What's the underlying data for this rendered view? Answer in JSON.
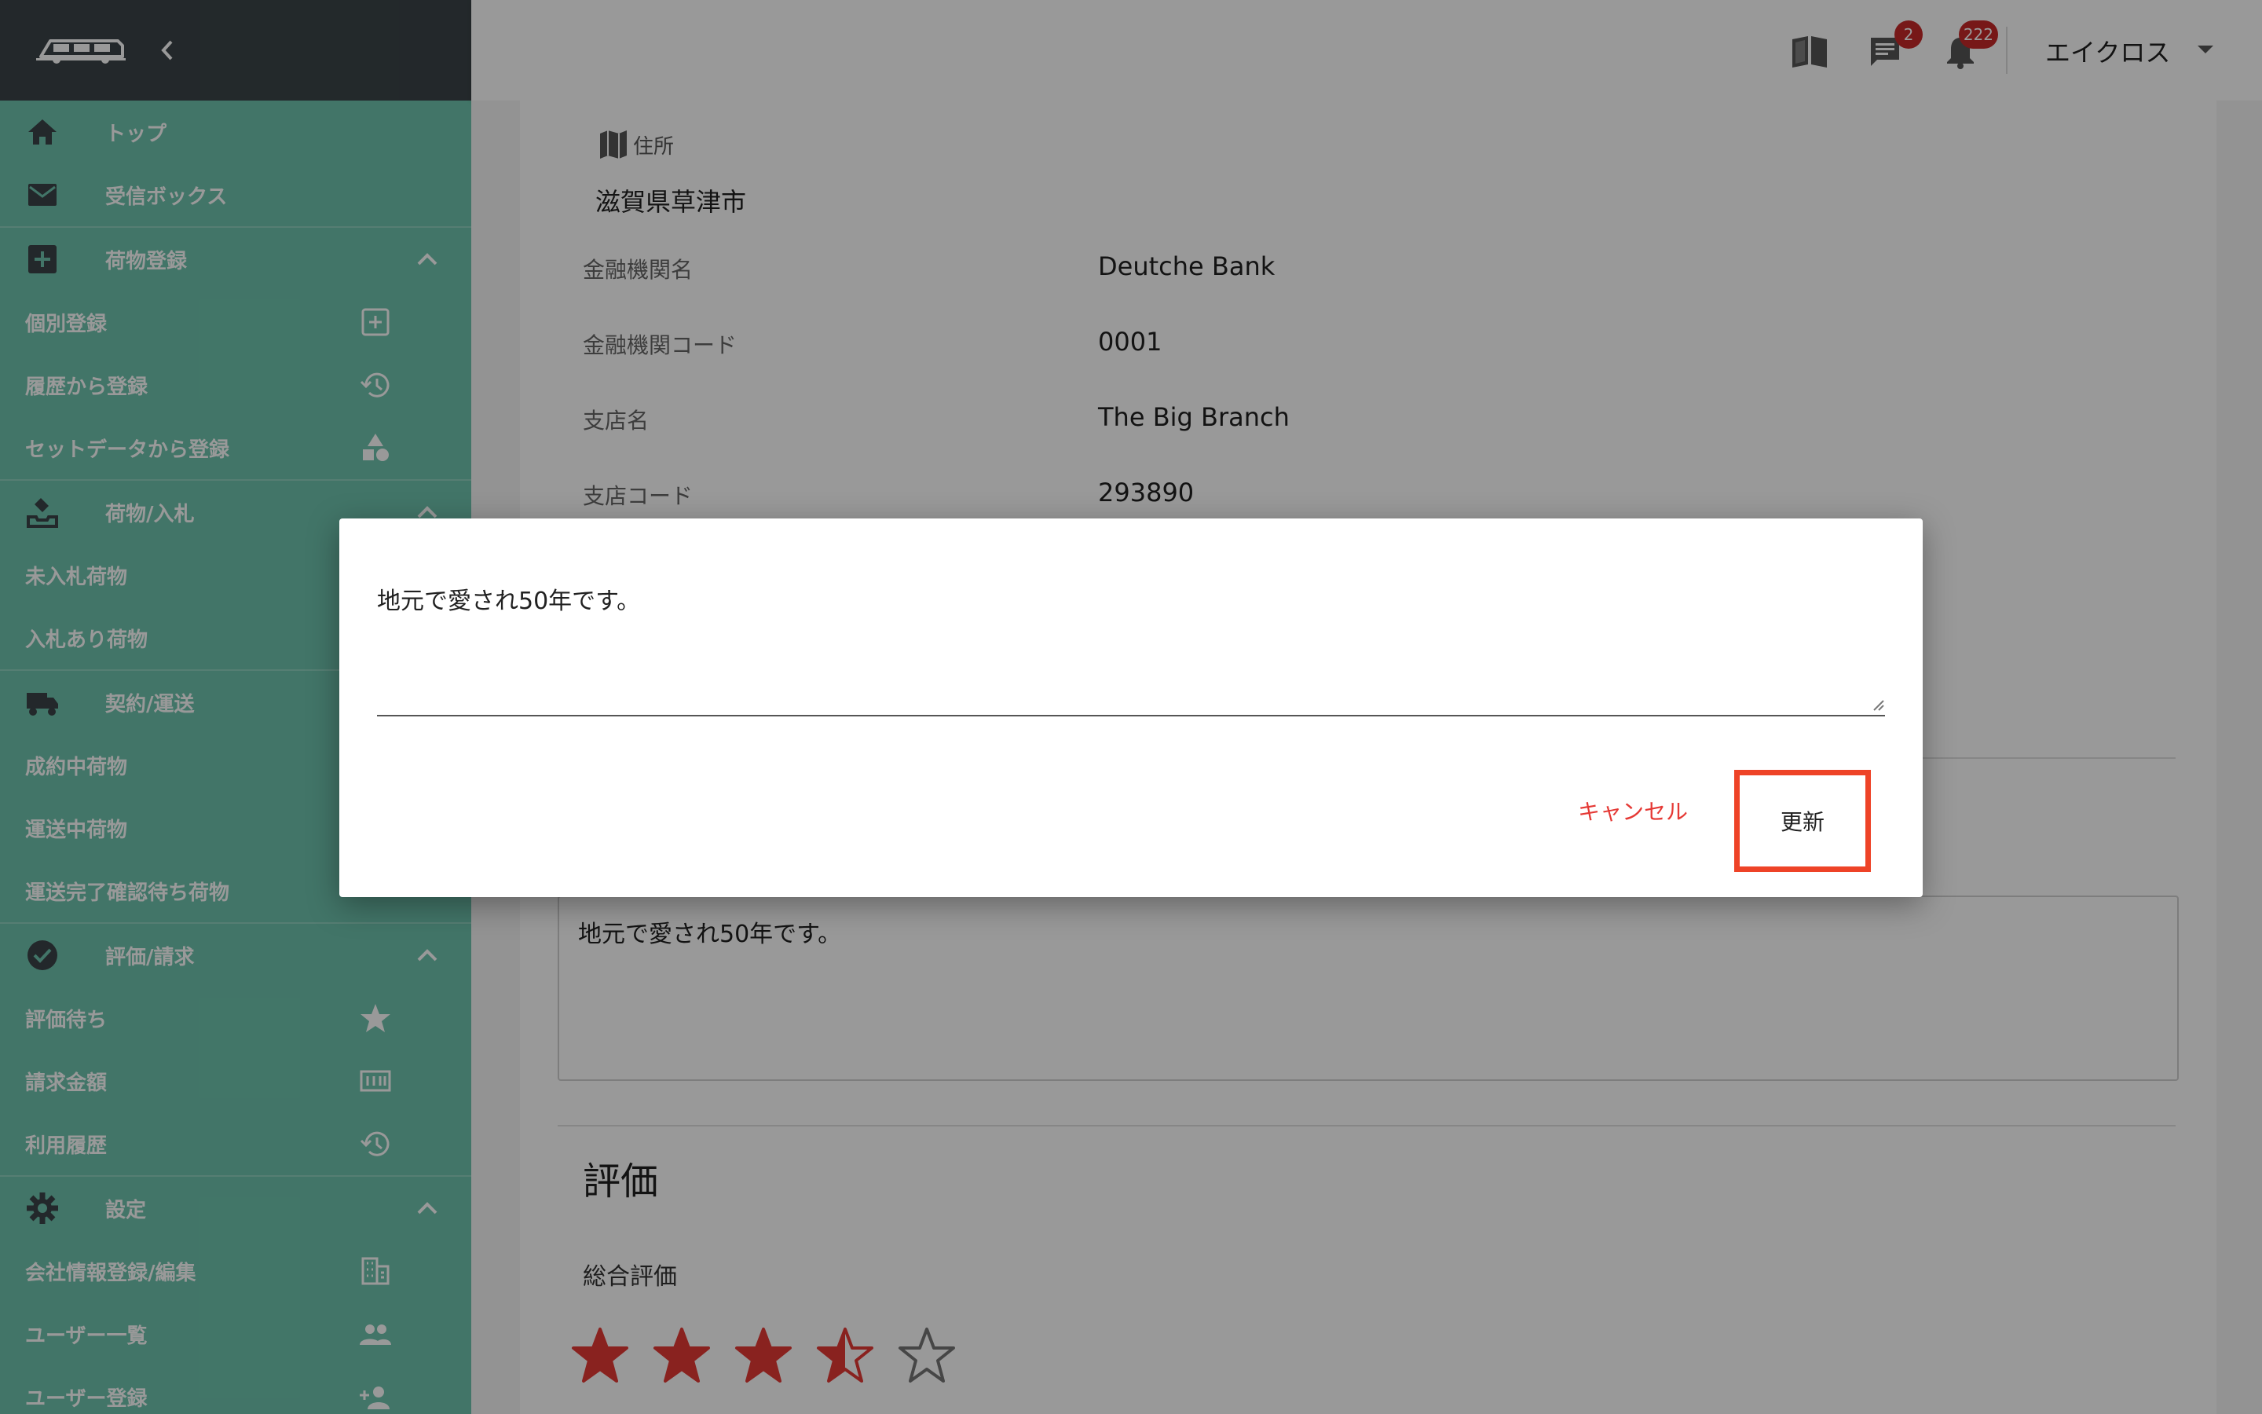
{
  "sidebar": {
    "items": [
      {
        "type": "group",
        "icon": "home-icon",
        "label": "トップ",
        "chevron": false
      },
      {
        "type": "group",
        "icon": "mail-icon",
        "label": "受信ボックス",
        "chevron": false
      },
      {
        "type": "divider"
      },
      {
        "type": "group",
        "icon": "add-box-icon",
        "label": "荷物登録",
        "chevron": true
      },
      {
        "type": "sub",
        "label": "個別登録",
        "icon": "add-square-icon"
      },
      {
        "type": "sub",
        "label": "履歴から登録",
        "icon": "history-icon"
      },
      {
        "type": "sub",
        "label": "セットデータから登録",
        "icon": "shapes-icon"
      },
      {
        "type": "divider"
      },
      {
        "type": "group",
        "icon": "inbox-tray-icon",
        "label": "荷物/入札",
        "chevron": true
      },
      {
        "type": "sub",
        "label": "未入札荷物",
        "icon": ""
      },
      {
        "type": "sub",
        "label": "入札あり荷物",
        "icon": ""
      },
      {
        "type": "divider"
      },
      {
        "type": "group",
        "icon": "truck-icon",
        "label": "契約/運送",
        "chevron": false
      },
      {
        "type": "sub",
        "label": "成約中荷物",
        "icon": ""
      },
      {
        "type": "sub",
        "label": "運送中荷物",
        "icon": ""
      },
      {
        "type": "sub",
        "label": "運送完了確認待ち荷物",
        "icon": ""
      },
      {
        "type": "divider"
      },
      {
        "type": "group",
        "icon": "check-circle-icon",
        "label": "評価/請求",
        "chevron": true
      },
      {
        "type": "sub",
        "label": "評価待ち",
        "icon": "star-icon"
      },
      {
        "type": "sub",
        "label": "請求金額",
        "icon": "counter-icon"
      },
      {
        "type": "sub",
        "label": "利用履歴",
        "icon": "history-icon"
      },
      {
        "type": "divider"
      },
      {
        "type": "group",
        "icon": "gear-icon",
        "label": "設定",
        "chevron": true
      },
      {
        "type": "sub",
        "label": "会社情報登録/編集",
        "icon": "building-icon"
      },
      {
        "type": "sub",
        "label": "ユーザー一覧",
        "icon": "people-icon"
      },
      {
        "type": "sub",
        "label": "ユーザー登録",
        "icon": "person-add-icon"
      }
    ]
  },
  "header": {
    "messages_badge": "2",
    "notifications_badge": "222",
    "user_name": "エイクロス"
  },
  "content": {
    "address_label": "住所",
    "address_value": "滋賀県草津市",
    "rows": [
      {
        "key": "金融機関名",
        "value": "Deutche Bank"
      },
      {
        "key": "金融機関コード",
        "value": "0001"
      },
      {
        "key": "支店名",
        "value": "The Big Branch"
      },
      {
        "key": "支店コード",
        "value": "293890"
      }
    ],
    "pr_text": "地元で愛され50年です。",
    "eval_title": "評価",
    "overall_label": "総合評価",
    "rating": 3.5,
    "rating_max": 5
  },
  "dialog": {
    "text": "地元で愛され50年です。",
    "cancel_label": "キャンセル",
    "update_label": "更新"
  },
  "colors": {
    "sidebar_bg": "#6ec4ad",
    "sidebar_top": "#3b4448",
    "star": "#e53935",
    "accent_red": "#e53935",
    "highlight": "#ee4327",
    "badge": "#c62828"
  }
}
